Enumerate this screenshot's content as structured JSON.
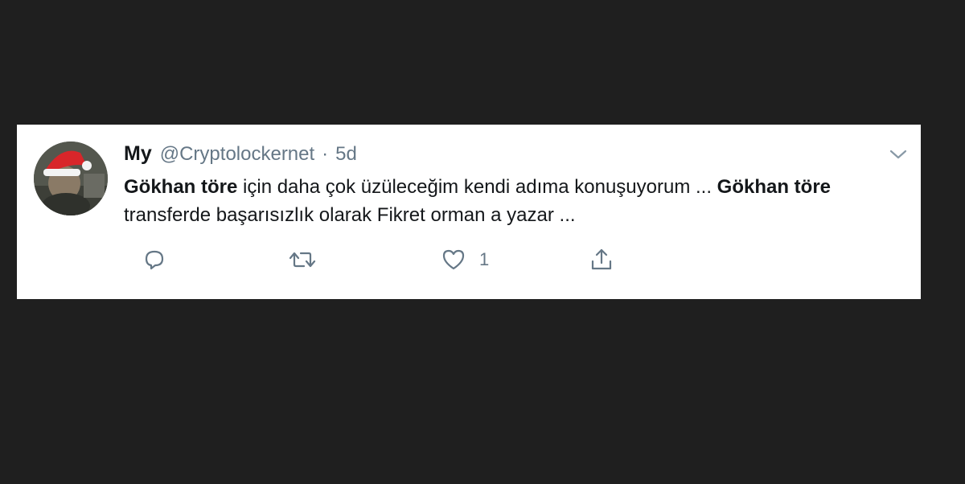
{
  "tweet": {
    "display_name": "My",
    "handle": "@Cryptolockernet",
    "separator": "·",
    "timestamp": "5d",
    "text_segments": [
      {
        "text": "Gökhan töre",
        "bold": true
      },
      {
        "text": " için daha çok üzüleceğim kendi adıma konuşuyorum ... ",
        "bold": false
      },
      {
        "text": "Gökhan töre",
        "bold": true
      },
      {
        "text": " transferde başarısızlık olarak Fikret orman a yazar ...",
        "bold": false
      }
    ],
    "actions": {
      "reply_icon": "reply-icon",
      "retweet_icon": "retweet-icon",
      "like_icon": "heart-icon",
      "like_count": "1",
      "share_icon": "share-icon"
    },
    "menu_icon": "chevron-down-icon"
  },
  "colors": {
    "background": "#1f1f1f",
    "card": "#ffffff",
    "text": "#14171a",
    "secondary": "#657786"
  }
}
